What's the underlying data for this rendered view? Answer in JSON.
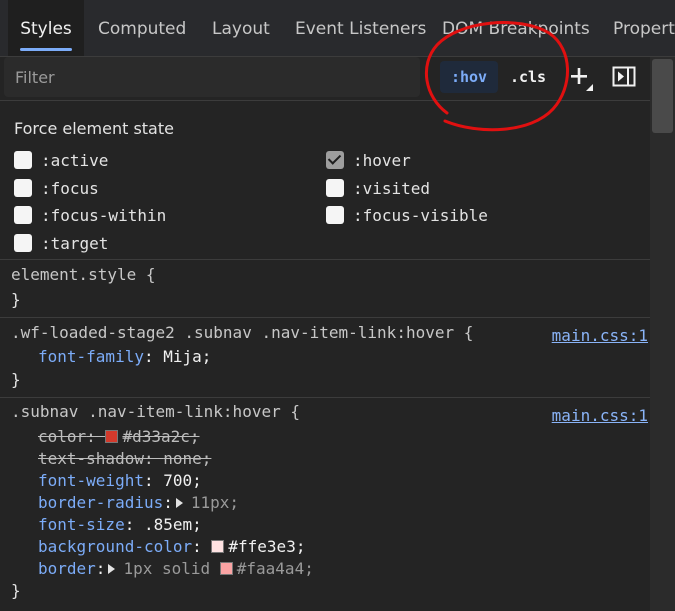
{
  "tabs": [
    {
      "label": "Styles",
      "active": true
    },
    {
      "label": "Computed"
    },
    {
      "label": "Layout"
    },
    {
      "label": "Event Listeners"
    },
    {
      "label": "DOM Breakpoints"
    },
    {
      "label": "Properties"
    }
  ],
  "toolbar": {
    "filter_placeholder": "Filter",
    "hov_label": ":hov",
    "cls_label": ".cls",
    "new_rule_icon": "plus-icon",
    "sidebar_icon": "toggle-sidebar-icon"
  },
  "force_state": {
    "title": "Force element state",
    "states": [
      {
        "label": ":active",
        "checked": false
      },
      {
        "label": ":hover",
        "checked": true
      },
      {
        "label": ":focus",
        "checked": false
      },
      {
        "label": ":visited",
        "checked": false
      },
      {
        "label": ":focus-within",
        "checked": false
      },
      {
        "label": ":focus-visible",
        "checked": false
      },
      {
        "label": ":target",
        "checked": false
      }
    ]
  },
  "rules": {
    "element_style": {
      "selector": "element.style {",
      "close": "}"
    },
    "rule1": {
      "selector": ".wf-loaded-stage2 .subnav .nav-item-link:hover {",
      "source": "main.css:1",
      "decls": [
        {
          "prop": "font-family",
          "value": "Mija;"
        }
      ],
      "close": "}"
    },
    "rule2": {
      "selector": ".subnav .nav-item-link:hover {",
      "source": "main.css:1",
      "decls": [
        {
          "prop": "color",
          "value": "#d33a2c;",
          "swatch": "#d33a2c",
          "struck": true
        },
        {
          "prop": "text-shadow",
          "value": "none;",
          "struck": true
        },
        {
          "prop": "font-weight",
          "value": "700;"
        },
        {
          "prop": "border-radius",
          "value": "11px;",
          "expandable": true
        },
        {
          "prop": "font-size",
          "value": ".85em;"
        },
        {
          "prop": "background-color",
          "value": "#ffe3e3;",
          "swatch": "#ffe3e3"
        },
        {
          "prop": "border",
          "value": "1px solid ",
          "value2": "#faa4a4;",
          "swatch": "#faa4a4",
          "expandable": true
        }
      ],
      "close": "}"
    }
  },
  "colors": {
    "accent": "#7cacf8",
    "annotation": "#e01010"
  }
}
